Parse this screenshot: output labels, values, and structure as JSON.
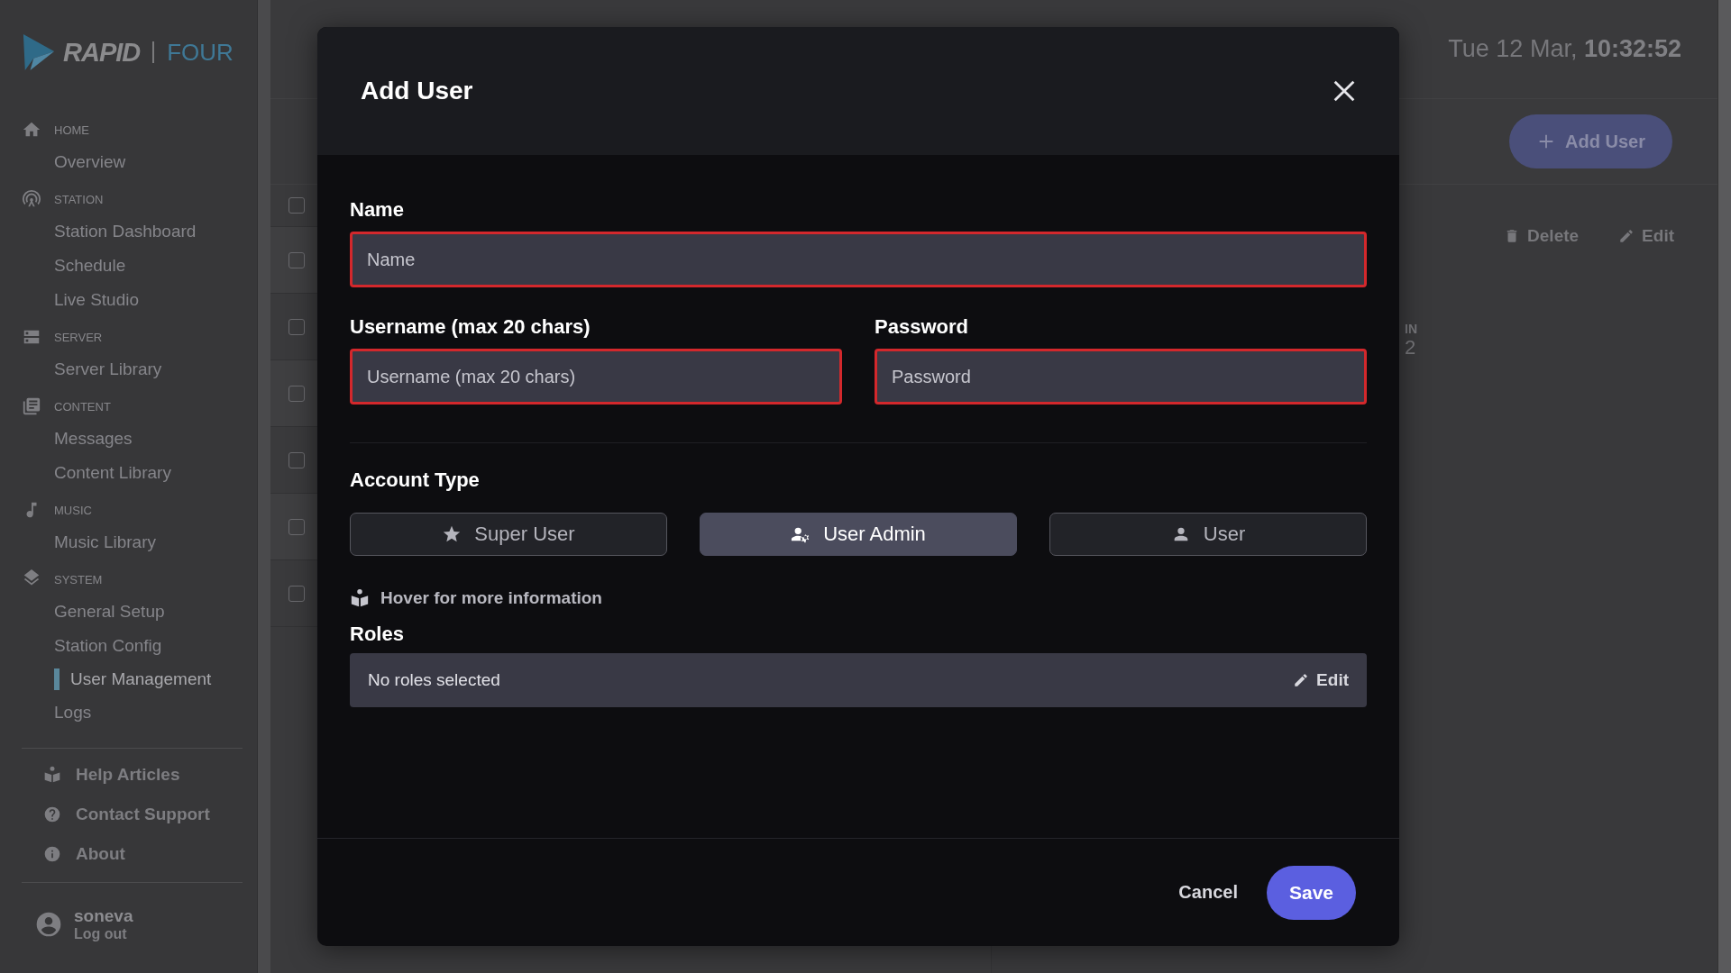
{
  "sidebar": {
    "logo": {
      "brand": "RAPID",
      "product": "FOUR"
    },
    "sections": [
      {
        "kind": "home",
        "title": "HOME",
        "items": [
          {
            "label": "Overview",
            "selected": false
          }
        ]
      },
      {
        "kind": "antenna",
        "title": "STATION",
        "items": [
          {
            "label": "Station Dashboard",
            "selected": false
          },
          {
            "label": "Schedule",
            "selected": false
          },
          {
            "label": "Live Studio",
            "selected": false
          }
        ]
      },
      {
        "kind": "server",
        "title": "SERVER",
        "items": [
          {
            "label": "Server Library",
            "selected": false
          }
        ]
      },
      {
        "kind": "content",
        "title": "CONTENT",
        "items": [
          {
            "label": "Messages",
            "selected": false
          },
          {
            "label": "Content Library",
            "selected": false
          }
        ]
      },
      {
        "kind": "music",
        "title": "MUSIC",
        "items": [
          {
            "label": "Music Library",
            "selected": false
          }
        ]
      },
      {
        "kind": "layers",
        "title": "SYSTEM",
        "items": [
          {
            "label": "General Setup",
            "selected": false
          },
          {
            "label": "Station Config",
            "selected": false
          },
          {
            "label": "User Management",
            "selected": true
          },
          {
            "label": "Logs",
            "selected": false
          }
        ]
      }
    ],
    "links": [
      {
        "kind": "book",
        "label": "Help Articles"
      },
      {
        "kind": "help",
        "label": "Contact Support"
      },
      {
        "kind": "info",
        "label": "About"
      }
    ],
    "user": {
      "name": "soneva",
      "action": "Log out"
    }
  },
  "header": {
    "date": "Tue 12 Mar,",
    "time": "10:32:52"
  },
  "toolbar": {
    "add_button": "Add User",
    "actions": [
      {
        "kind": "delete",
        "label": "Delete"
      },
      {
        "kind": "edit",
        "label": "Edit"
      }
    ]
  },
  "table": {
    "rows": [
      {
        "checked": false
      },
      {
        "checked": false
      },
      {
        "checked": false
      },
      {
        "checked": false
      },
      {
        "checked": false
      },
      {
        "checked": false
      },
      {
        "checked": false
      }
    ],
    "column_heading": "IN",
    "cell": "2"
  },
  "modal": {
    "title": "Add User",
    "fields": [
      {
        "label": "Name",
        "placeholder": "Name",
        "invalid": true
      },
      {
        "label": "Username (max 20 chars)",
        "placeholder": "Username (max 20 chars)",
        "invalid": true
      },
      {
        "label": "Password",
        "placeholder": "Password",
        "invalid": true
      }
    ],
    "account_type": {
      "label": "Account Type",
      "options": [
        {
          "kind": "star",
          "label": "Super User",
          "selected": false
        },
        {
          "kind": "user-gear",
          "label": "User Admin",
          "selected": true
        },
        {
          "kind": "person",
          "label": "User",
          "selected": false
        }
      ]
    },
    "hint": "Hover for more information",
    "roles": {
      "label": "Roles",
      "value": "No roles selected",
      "edit": "Edit"
    },
    "cancel": "Cancel",
    "save": "Save"
  }
}
